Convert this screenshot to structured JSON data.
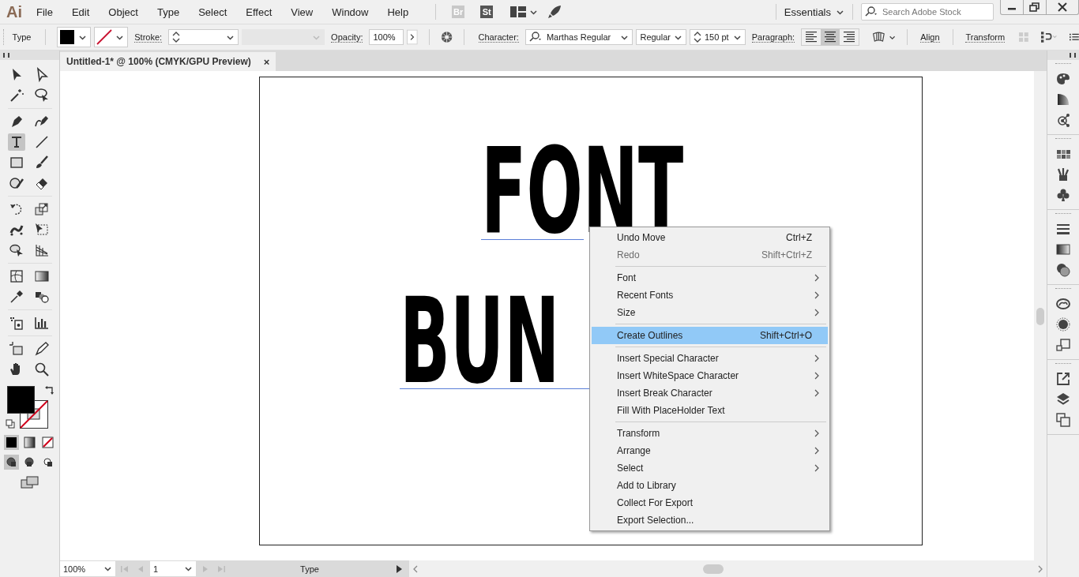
{
  "menu_bar": {
    "logo": "Ai",
    "items": [
      "File",
      "Edit",
      "Object",
      "Type",
      "Select",
      "Effect",
      "View",
      "Window",
      "Help"
    ],
    "app_badges": [
      "Br",
      "St"
    ],
    "workspace": "Essentials",
    "search": {
      "placeholder": "Search Adobe Stock"
    }
  },
  "control_bar": {
    "tool_label": "Type",
    "stroke_label": "Stroke:",
    "opacity_label": "Opacity:",
    "opacity": "100%",
    "character_label": "Character:",
    "font": "Marthas Regular",
    "style": "Regular",
    "size": "150 pt",
    "paragraph_label": "Paragraph:",
    "alignments": [
      {
        "selected": false
      },
      {
        "selected": true
      },
      {
        "selected": false
      }
    ],
    "links": [
      "Align",
      "Transform"
    ]
  },
  "document_tab": {
    "title": "Untitled-1* @ 100% (CMYK/GPU Preview)",
    "close": "×"
  },
  "tools": [
    {
      "selected": false
    },
    {
      "selected": false
    },
    {
      "selected": false
    },
    {
      "selected": false
    },
    {
      "selected": false
    },
    {
      "selected": false
    },
    {
      "selected": true
    },
    {
      "selected": false
    },
    {
      "selected": false
    },
    {
      "selected": false
    },
    {
      "selected": false
    },
    {
      "selected": false
    },
    {
      "selected": false
    },
    {
      "selected": false
    },
    {
      "selected": false
    },
    {
      "selected": false
    },
    {
      "selected": false
    },
    {
      "selected": false
    },
    {
      "selected": false
    },
    {
      "selected": false
    },
    {
      "selected": false
    },
    {
      "selected": false
    },
    {
      "selected": false
    },
    {
      "selected": false
    },
    {
      "selected": false
    },
    {
      "selected": false
    },
    {
      "selected": false
    },
    {
      "selected": false
    }
  ],
  "color_modes": [
    {
      "selected": true
    },
    {
      "selected": false
    },
    {
      "selected": false
    }
  ],
  "draw_modes": [
    {
      "selected": true
    },
    {
      "selected": false
    },
    {
      "selected": false
    }
  ],
  "artboard": {
    "lines": [
      "FONT",
      "BUN"
    ]
  },
  "context_menu": [
    {
      "kind": "item",
      "label": "Undo Move",
      "shortcut": "Ctrl+Z",
      "disabled": false,
      "submenu": false,
      "selected": false
    },
    {
      "kind": "item",
      "label": "Redo",
      "shortcut": "Shift+Ctrl+Z",
      "disabled": true,
      "submenu": false,
      "selected": false
    },
    {
      "kind": "separator"
    },
    {
      "kind": "item",
      "label": "Font",
      "disabled": false,
      "submenu": true,
      "selected": false
    },
    {
      "kind": "item",
      "label": "Recent Fonts",
      "disabled": false,
      "submenu": true,
      "selected": false
    },
    {
      "kind": "item",
      "label": "Size",
      "disabled": false,
      "submenu": true,
      "selected": false
    },
    {
      "kind": "separator"
    },
    {
      "kind": "item",
      "label": "Create Outlines",
      "shortcut": "Shift+Ctrl+O",
      "disabled": false,
      "submenu": false,
      "selected": true
    },
    {
      "kind": "separator"
    },
    {
      "kind": "item",
      "label": "Insert Special Character",
      "disabled": false,
      "submenu": true,
      "selected": false
    },
    {
      "kind": "item",
      "label": "Insert WhiteSpace Character",
      "disabled": false,
      "submenu": true,
      "selected": false
    },
    {
      "kind": "item",
      "label": "Insert Break Character",
      "disabled": false,
      "submenu": true,
      "selected": false
    },
    {
      "kind": "item",
      "label": "Fill With PlaceHolder Text",
      "disabled": false,
      "submenu": false,
      "selected": false
    },
    {
      "kind": "separator"
    },
    {
      "kind": "item",
      "label": "Transform",
      "disabled": false,
      "submenu": true,
      "selected": false
    },
    {
      "kind": "item",
      "label": "Arrange",
      "disabled": false,
      "submenu": true,
      "selected": false
    },
    {
      "kind": "item",
      "label": "Select",
      "disabled": false,
      "submenu": true,
      "selected": false
    },
    {
      "kind": "item",
      "label": "Add to Library",
      "disabled": false,
      "submenu": false,
      "selected": false
    },
    {
      "kind": "item",
      "label": "Collect For Export",
      "disabled": false,
      "submenu": false,
      "selected": false
    },
    {
      "kind": "item",
      "label": "Export Selection...",
      "disabled": false,
      "submenu": false,
      "selected": false
    }
  ],
  "status_bar": {
    "zoom": "100%",
    "artboard": "1",
    "tool": "Type"
  }
}
